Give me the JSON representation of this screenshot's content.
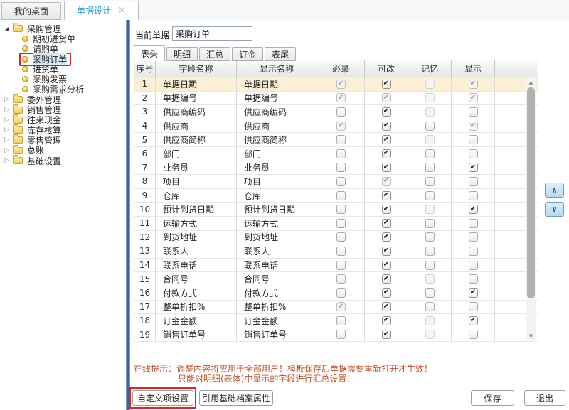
{
  "window": {
    "tabs": [
      {
        "label": "我的桌面",
        "active": false
      },
      {
        "label": "单据设计",
        "active": true
      }
    ],
    "close_icon": "×"
  },
  "sidebar": {
    "root": "采购管理",
    "items": [
      "期初进货单",
      "请购单",
      "采购订单",
      "进货单",
      "采购发票",
      "采购需求分析"
    ],
    "selected_item": "采购订单",
    "collapsed_groups": [
      "委外管理",
      "销售管理",
      "往来现金",
      "库存核算",
      "零售管理",
      "总账",
      "基础设置"
    ]
  },
  "main": {
    "current_doc": {
      "label": "当前单据",
      "value": "采购订单"
    },
    "view_tabs": [
      "表头",
      "明细",
      "汇总",
      "订金",
      "表尾"
    ],
    "active_view_tab": "表头",
    "table": {
      "headers": [
        "序号",
        "字段名称",
        "显示名称",
        "必录",
        "可改",
        "记忆",
        "显示"
      ],
      "rows": [
        {
          "no": "1",
          "field": "单据日期",
          "display": "单据日期",
          "required": "checked-disabled",
          "editable": "checked",
          "memory": "unchecked-disabled",
          "show": "checked-disabled",
          "highlighted": true
        },
        {
          "no": "2",
          "field": "单据编号",
          "display": "单据编号",
          "required": "checked-disabled",
          "editable": "checked-disabled",
          "memory": "unchecked-disabled",
          "show": "checked-disabled",
          "highlighted": false
        },
        {
          "no": "3",
          "field": "供应商编码",
          "display": "供应商编码",
          "required": "unchecked",
          "editable": "checked",
          "memory": "unchecked-disabled",
          "show": "unchecked",
          "highlighted": false
        },
        {
          "no": "4",
          "field": "供应商",
          "display": "供应商",
          "required": "checked-disabled",
          "editable": "checked",
          "memory": "unchecked",
          "show": "checked-disabled",
          "highlighted": false
        },
        {
          "no": "5",
          "field": "供应商简称",
          "display": "供应商简称",
          "required": "unchecked",
          "editable": "checked",
          "memory": "unchecked-disabled",
          "show": "unchecked",
          "highlighted": false
        },
        {
          "no": "6",
          "field": "部门",
          "display": "部门",
          "required": "unchecked",
          "editable": "checked",
          "memory": "unchecked",
          "show": "unchecked",
          "highlighted": false
        },
        {
          "no": "7",
          "field": "业务员",
          "display": "业务员",
          "required": "unchecked",
          "editable": "checked",
          "memory": "unchecked",
          "show": "checked",
          "highlighted": false
        },
        {
          "no": "8",
          "field": "项目",
          "display": "项目",
          "required": "unchecked",
          "editable": "checked-disabled",
          "memory": "unchecked",
          "show": "unchecked",
          "highlighted": false
        },
        {
          "no": "9",
          "field": "仓库",
          "display": "仓库",
          "required": "unchecked",
          "editable": "checked",
          "memory": "unchecked",
          "show": "unchecked",
          "highlighted": false
        },
        {
          "no": "10",
          "field": "预计到货日期",
          "display": "预计到货日期",
          "required": "unchecked",
          "editable": "checked",
          "memory": "unchecked-disabled",
          "show": "checked",
          "highlighted": false
        },
        {
          "no": "11",
          "field": "运输方式",
          "display": "运输方式",
          "required": "unchecked",
          "editable": "checked",
          "memory": "unchecked",
          "show": "unchecked",
          "highlighted": false
        },
        {
          "no": "12",
          "field": "到货地址",
          "display": "到货地址",
          "required": "unchecked",
          "editable": "checked",
          "memory": "unchecked",
          "show": "unchecked",
          "highlighted": false
        },
        {
          "no": "13",
          "field": "联系人",
          "display": "联系人",
          "required": "unchecked",
          "editable": "checked",
          "memory": "unchecked",
          "show": "unchecked",
          "highlighted": false
        },
        {
          "no": "14",
          "field": "联系电话",
          "display": "联系电话",
          "required": "unchecked",
          "editable": "checked",
          "memory": "unchecked",
          "show": "unchecked",
          "highlighted": false
        },
        {
          "no": "15",
          "field": "合同号",
          "display": "合同号",
          "required": "unchecked",
          "editable": "checked",
          "memory": "unchecked-disabled",
          "show": "unchecked",
          "highlighted": false
        },
        {
          "no": "16",
          "field": "付款方式",
          "display": "付款方式",
          "required": "unchecked",
          "editable": "checked",
          "memory": "unchecked",
          "show": "checked",
          "highlighted": false
        },
        {
          "no": "17",
          "field": "整单折扣%",
          "display": "整单折扣%",
          "required": "checked-disabled",
          "editable": "checked",
          "memory": "unchecked",
          "show": "unchecked",
          "highlighted": false
        },
        {
          "no": "18",
          "field": "订金金额",
          "display": "订金金额",
          "required": "unchecked",
          "editable": "checked",
          "memory": "unchecked-disabled",
          "show": "checked",
          "highlighted": false
        },
        {
          "no": "19",
          "field": "销售订单号",
          "display": "销售订单号",
          "required": "unchecked",
          "editable": "checked",
          "memory": "unchecked-disabled",
          "show": "unchecked",
          "highlighted": false
        }
      ]
    },
    "hint": {
      "prefix": "在线提示：",
      "line1": "调整内容将应用于全部用户！模板保存后单据需要重新打开才生效！",
      "line2": "只能对明细(表体)中显示的字段进行汇总设置！"
    },
    "buttons": {
      "custom_fields": "自定义项设置",
      "ref_base": "引用基础档案属性",
      "save": "保存",
      "exit": "退出"
    }
  },
  "icons": {
    "check": "✔",
    "collapsed_arrow": "▷",
    "scroll_up": "▲",
    "scroll_down": "▼",
    "chevron_up": "∧",
    "chevron_down": "∨"
  },
  "colors": {
    "accent_blue": "#2e9bd6",
    "row_highlight": "#fcefd6",
    "hint_red": "#bf5028",
    "annotation_red": "#e0241b",
    "splitter_blue": "#40619b",
    "folder_yellow": "#f7cd5d"
  }
}
